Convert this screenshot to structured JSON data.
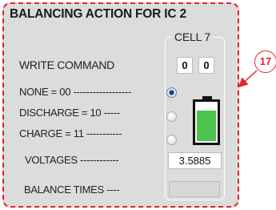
{
  "panel": {
    "title": "BALANCING ACTION FOR IC 2",
    "labels": {
      "write_command": "WRITE COMMAND",
      "none": "NONE = 00 ------------------",
      "discharge": "DISCHARGE = 10 -----",
      "charge": "CHARGE = 11 -----------",
      "voltages": "VOLTAGES ------------",
      "balance_times": "BALANCE TIMES ----"
    }
  },
  "cell": {
    "group_title": "CELL 7",
    "write_command": [
      "0",
      "0"
    ],
    "action_options": [
      {
        "name": "none",
        "selected": true
      },
      {
        "name": "discharge",
        "selected": false
      },
      {
        "name": "charge",
        "selected": false
      }
    ],
    "battery_level": 0.8,
    "battery_color": "#4cc34c",
    "voltage": "3.5885",
    "balance_time": ""
  },
  "annotation": {
    "callout_number": "17",
    "color": "#e8202c"
  }
}
